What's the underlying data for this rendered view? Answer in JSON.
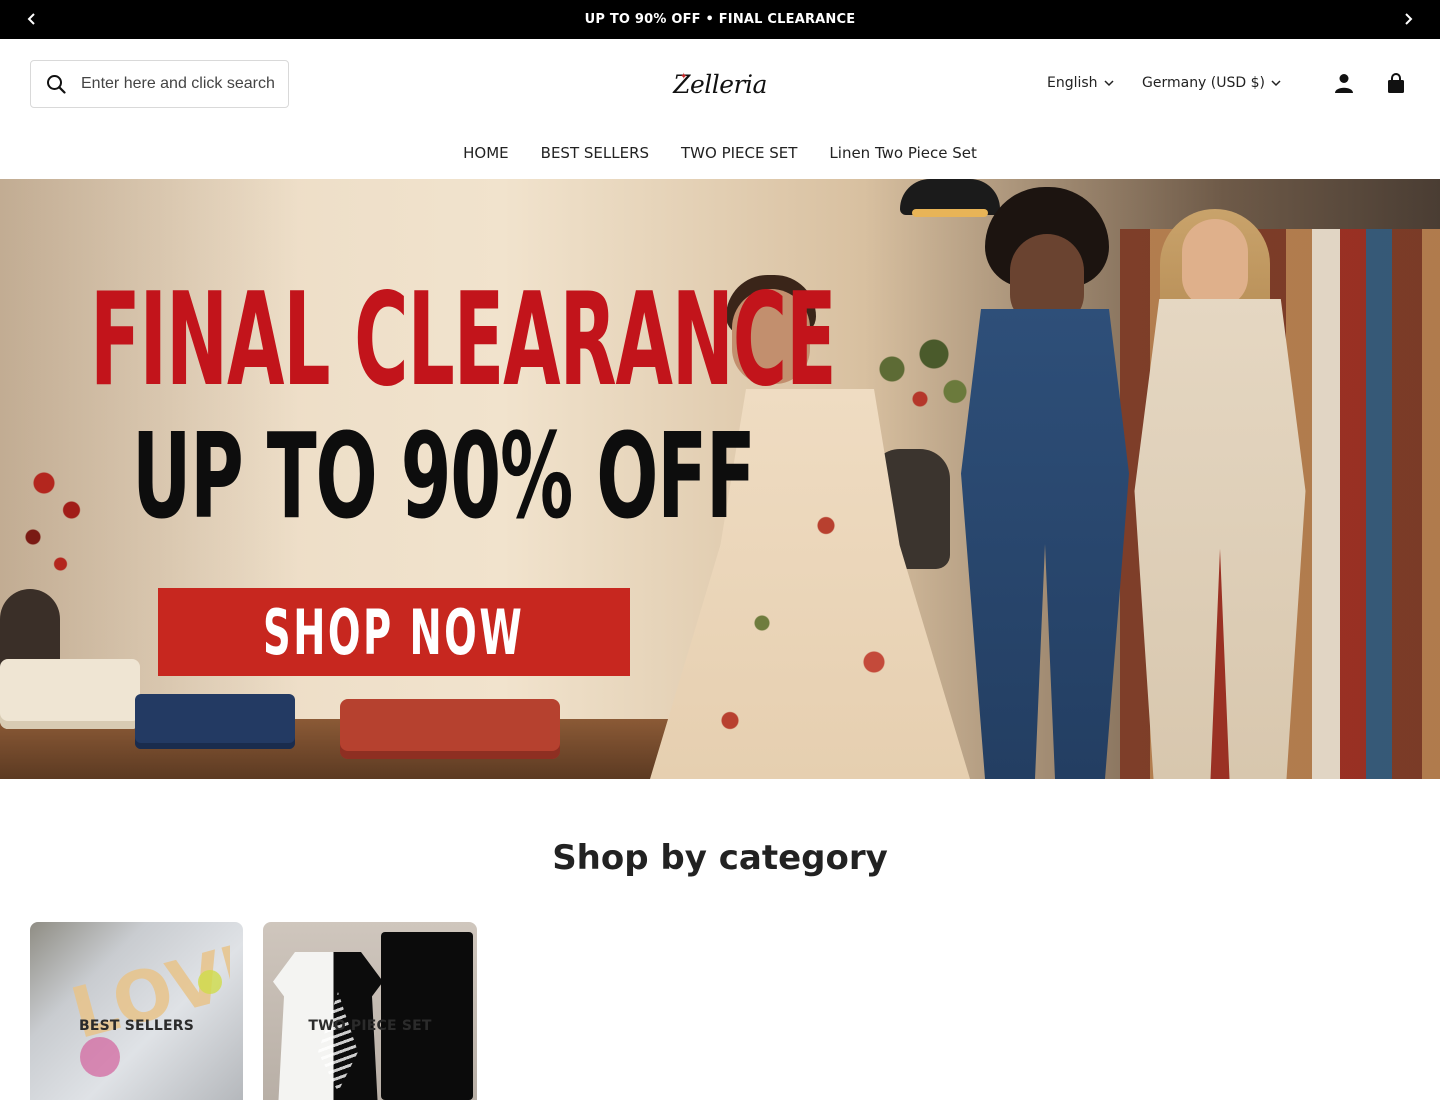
{
  "announcement": {
    "text": "UP TO 90% OFF • FINAL CLEARANCE",
    "prev_icon": "chevron-left-icon",
    "next_icon": "chevron-right-icon"
  },
  "header": {
    "search": {
      "placeholder": "Enter here and click search",
      "value": "",
      "icon": "search-icon"
    },
    "logo_text": "Zelleria",
    "language": {
      "selected": "English",
      "icon": "chevron-down-icon"
    },
    "country": {
      "selected": "Germany (USD $)",
      "icon": "chevron-down-icon"
    },
    "account_icon": "user-icon",
    "cart_icon": "shopping-bag-icon"
  },
  "nav": {
    "items": [
      {
        "label": "HOME"
      },
      {
        "label": "BEST SELLERS"
      },
      {
        "label": "TWO PIECE SET"
      },
      {
        "label": "Linen Two Piece Set"
      }
    ]
  },
  "hero": {
    "line1": "FINAL CLEARANCE",
    "line2": "UP TO 90% OFF",
    "cta": "SHOP NOW"
  },
  "categories": {
    "title": "Shop by category",
    "items": [
      {
        "label": "BEST SELLERS"
      },
      {
        "label": "TWO PIECE SET"
      }
    ]
  },
  "colors": {
    "announcement_bg": "#000000",
    "hero_red": "#c2141b",
    "cta_bg": "#c7271f"
  }
}
